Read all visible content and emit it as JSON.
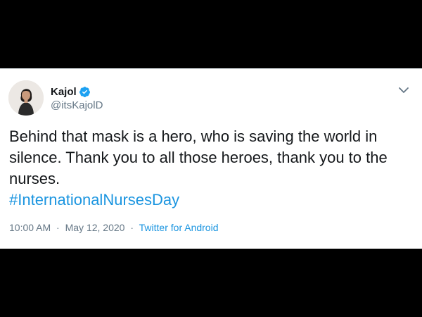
{
  "tweet": {
    "author": {
      "name": "Kajol",
      "handle": "@itsKajolD",
      "verified": true
    },
    "text": "Behind that mask is a hero, who is saving the world in silence. Thank you to all those heroes, thank you to the nurses.",
    "hashtag": "#InternationalNursesDay",
    "time": "10:00 AM",
    "separator": "·",
    "date": "May 12, 2020",
    "source": "Twitter for Android"
  },
  "icons": {
    "verified": "verified-badge-icon",
    "menu": "chevron-down-icon"
  },
  "colors": {
    "background": "#000000",
    "card": "#ffffff",
    "link": "#1b95e0",
    "text": "#14171a",
    "muted": "#657786",
    "verified": "#1da1f2"
  }
}
